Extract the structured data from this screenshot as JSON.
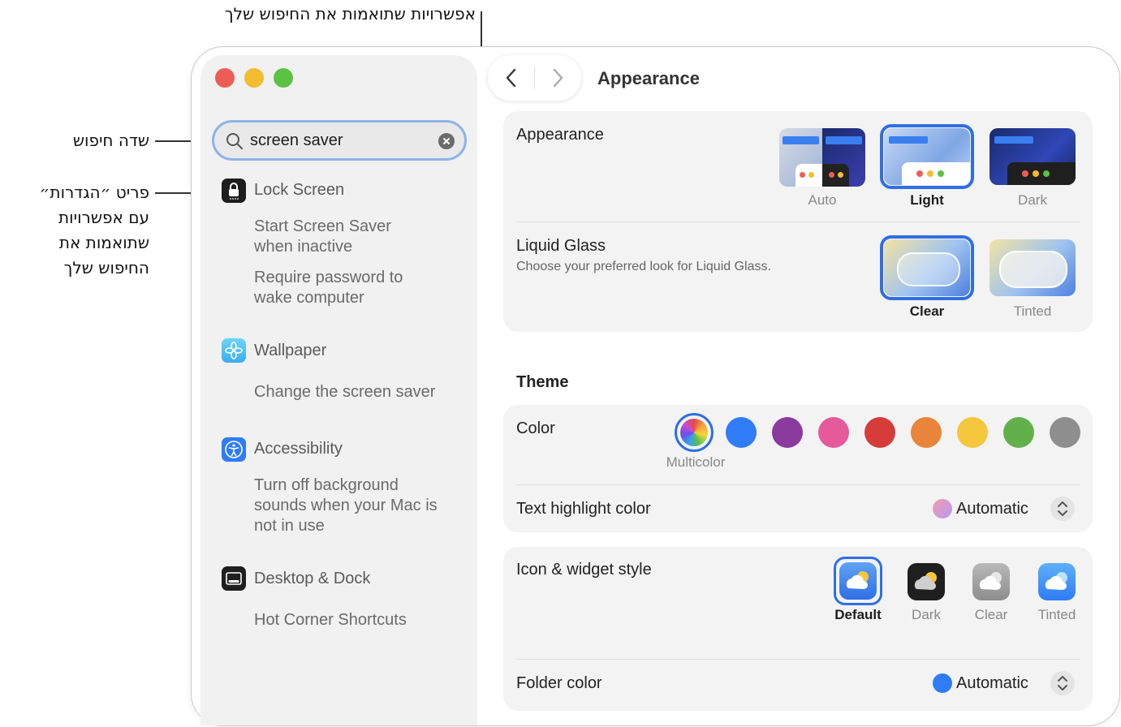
{
  "callouts": {
    "matching_options": "אפשרויות שתואמות את החיפוש שלך",
    "search_field": "שדה חיפוש",
    "settings_item_lines": [
      "פריט ״הגדרות״",
      "עם אפשרויות",
      "שתואמות את",
      "החיפוש שלך"
    ]
  },
  "sidebar": {
    "search": {
      "value": "screen saver"
    },
    "items": [
      {
        "title": "Lock Screen",
        "icon": "lock-icon",
        "subitems": [
          [
            "Start Screen Saver",
            "when inactive"
          ],
          [
            "Require password to",
            "wake computer"
          ]
        ]
      },
      {
        "title": "Wallpaper",
        "icon": "flower-icon",
        "subitems": [
          [
            "Change the screen saver"
          ]
        ]
      },
      {
        "title": "Accessibility",
        "icon": "accessibility-icon",
        "subitems": [
          [
            "Turn off background",
            "sounds when your Mac is",
            "not in use"
          ]
        ]
      },
      {
        "title": "Desktop & Dock",
        "icon": "dock-icon",
        "subitems": [
          [
            "Hot Corner Shortcuts"
          ]
        ]
      }
    ]
  },
  "main": {
    "title": "Appearance",
    "appearance": {
      "label": "Appearance",
      "options": [
        "Auto",
        "Light",
        "Dark"
      ],
      "selected": "Light"
    },
    "liquid_glass": {
      "label": "Liquid Glass",
      "description": "Choose your preferred look for Liquid Glass.",
      "options": [
        "Clear",
        "Tinted"
      ],
      "selected": "Clear"
    },
    "theme": {
      "heading": "Theme",
      "color_label": "Color",
      "colors": [
        {
          "name": "Multicolor",
          "hex": "multicolor"
        },
        {
          "name": "Blue",
          "hex": "#2f7cf6"
        },
        {
          "name": "Purple",
          "hex": "#8b3a9e"
        },
        {
          "name": "Pink",
          "hex": "#e45a9b"
        },
        {
          "name": "Red",
          "hex": "#d63c3a"
        },
        {
          "name": "Orange",
          "hex": "#e8853a"
        },
        {
          "name": "Yellow",
          "hex": "#f5c73d"
        },
        {
          "name": "Green",
          "hex": "#62b04a"
        },
        {
          "name": "Graphite",
          "hex": "#8e8e8e"
        }
      ],
      "selected_color_caption": "Multicolor",
      "text_highlight_label": "Text highlight color",
      "text_highlight_value": "Automatic"
    },
    "icon_widget": {
      "label": "Icon & widget style",
      "options": [
        "Default",
        "Dark",
        "Clear",
        "Tinted"
      ],
      "selected": "Default",
      "folder_color_label": "Folder color",
      "folder_color_value": "Automatic"
    }
  }
}
